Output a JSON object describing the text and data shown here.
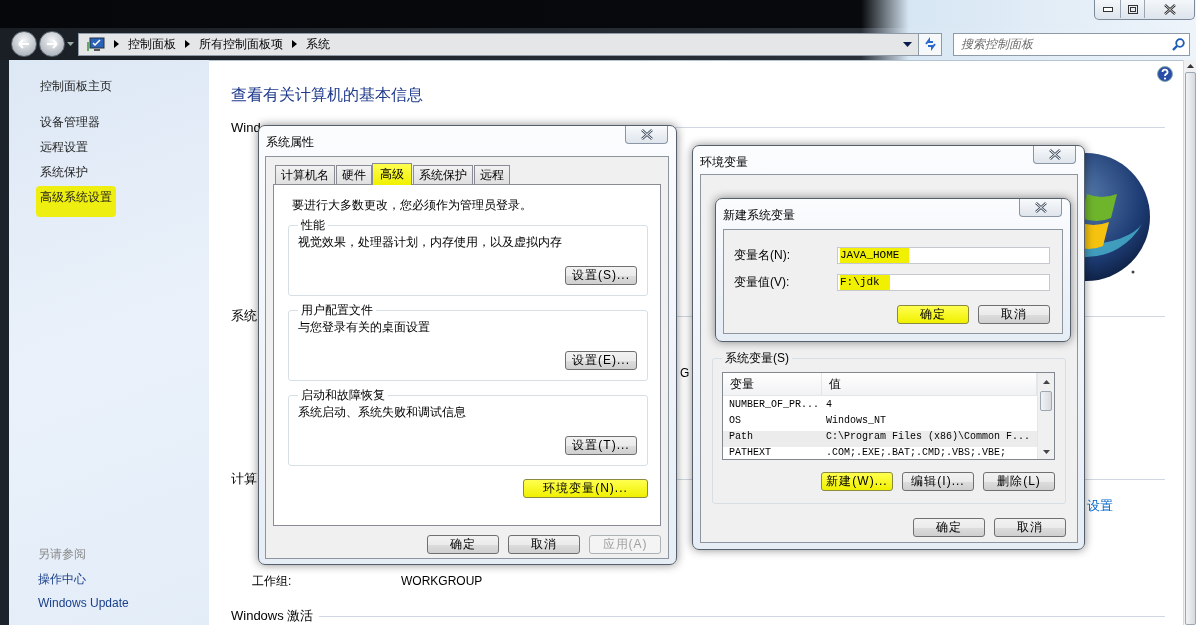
{
  "explorer": {
    "breadcrumb": [
      {
        "label": "控制面板"
      },
      {
        "label": "所有控制面板项"
      },
      {
        "label": "系统"
      }
    ],
    "search": {
      "placeholder": "搜索控制面板"
    },
    "sidebar": {
      "items": [
        {
          "label": "控制面板主页",
          "highlighted": false
        },
        {
          "label": "设备管理器",
          "highlighted": false
        },
        {
          "label": "远程设置",
          "highlighted": false
        },
        {
          "label": "系统保护",
          "highlighted": false
        },
        {
          "label": "高级系统设置",
          "highlighted": true
        }
      ],
      "see_also_title": "另请参阅",
      "see_also": [
        {
          "label": "操作中心"
        },
        {
          "label": "Windows Update"
        }
      ]
    },
    "content": {
      "heading": "查看有关计算机的基本信息",
      "sections": [
        {
          "title": "Wind"
        },
        {
          "title": "系统",
          "rows": [
            {
              "trailing": "G"
            }
          ]
        },
        {
          "title": "计算",
          "rows": [
            {
              "link": "设置"
            },
            {
              "label": "工作组:",
              "value": "WORKGROUP"
            }
          ]
        },
        {
          "title": "Windows 激活"
        }
      ]
    }
  },
  "system_properties": {
    "title": "系统属性",
    "tabs": [
      {
        "label": "计算机名",
        "selected": false,
        "highlighted": false
      },
      {
        "label": "硬件",
        "selected": false,
        "highlighted": false
      },
      {
        "label": "高级",
        "selected": true,
        "highlighted": true
      },
      {
        "label": "系统保护",
        "selected": false,
        "highlighted": false
      },
      {
        "label": "远程",
        "selected": false,
        "highlighted": false
      }
    ],
    "notice": "要进行大多数更改，您必须作为管理员登录。",
    "groups": [
      {
        "title": "性能",
        "description": "视觉效果，处理器计划，内存使用，以及虚拟内存",
        "button": "设置(S)..."
      },
      {
        "title": "用户配置文件",
        "description": "与您登录有关的桌面设置",
        "button": "设置(E)..."
      },
      {
        "title": "启动和故障恢复",
        "description": "系统启动、系统失败和调试信息",
        "button": "设置(T)..."
      }
    ],
    "env_button": {
      "label": "环境变量(N)...",
      "highlighted": true
    },
    "buttons": [
      {
        "label": "确定",
        "disabled": false
      },
      {
        "label": "取消",
        "disabled": false
      },
      {
        "label": "应用(A)",
        "disabled": true
      }
    ]
  },
  "environment_variables": {
    "title": "环境变量",
    "system_vars": {
      "title": "系统变量(S)",
      "columns": [
        "变量",
        "值"
      ],
      "rows": [
        {
          "name": "NUMBER_OF_PR...",
          "value": "4",
          "selected": false
        },
        {
          "name": "OS",
          "value": "Windows_NT",
          "selected": false
        },
        {
          "name": "Path",
          "value": "C:\\Program Files (x86)\\Common F...",
          "selected": true
        },
        {
          "name": "PATHEXT",
          "value": ".COM;.EXE;.BAT;.CMD;.VBS;.VBE;",
          "selected": false
        }
      ],
      "buttons": [
        {
          "label": "新建(W)...",
          "highlighted": true
        },
        {
          "label": "编辑(I)...",
          "highlighted": false
        },
        {
          "label": "删除(L)",
          "highlighted": false
        }
      ]
    },
    "buttons": [
      {
        "label": "确定"
      },
      {
        "label": "取消"
      }
    ]
  },
  "new_system_variable": {
    "title": "新建系统变量",
    "fields": [
      {
        "label": "变量名(N):",
        "value": "JAVA_HOME",
        "highlighted": true
      },
      {
        "label": "变量值(V):",
        "value": "F:\\jdk",
        "highlighted": true
      }
    ],
    "buttons": [
      {
        "label": "确定",
        "highlighted": true
      },
      {
        "label": "取消",
        "highlighted": false
      }
    ]
  }
}
